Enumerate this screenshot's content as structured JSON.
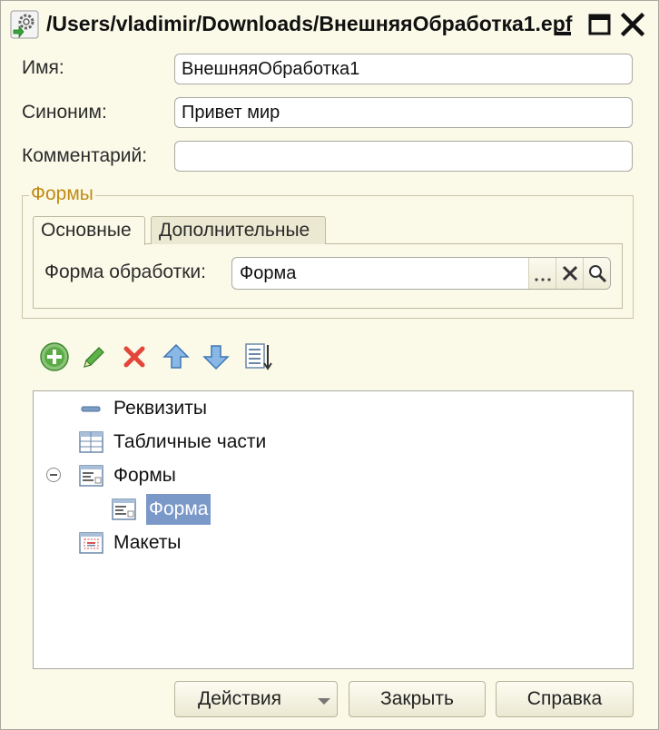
{
  "window": {
    "title": "/Users/vladimir/Downloads/ВнешняяОбработка1.epf"
  },
  "fields": {
    "name_label": "Имя:",
    "name_value": "ВнешняяОбработка1",
    "synonym_label": "Синоним:",
    "synonym_value": "Привет мир",
    "comment_label": "Комментарий:",
    "comment_value": ""
  },
  "forms_group": {
    "title": "Формы",
    "tabs": [
      {
        "label": "Основные",
        "active": true
      },
      {
        "label": "Дополнительные",
        "active": false
      }
    ],
    "form_label": "Форма обработки:",
    "form_value": "Форма",
    "choose_button": "...",
    "clear_icon": "clear-x-icon",
    "open_icon": "magnifier-icon"
  },
  "toolbar": {
    "items": [
      "add-icon",
      "edit-icon",
      "delete-icon",
      "move-up-icon",
      "move-down-icon",
      "sort-list-icon"
    ]
  },
  "tree": {
    "items": [
      {
        "label": "Реквизиты",
        "icon": "attributes-icon",
        "level": 0
      },
      {
        "label": "Табличные части",
        "icon": "table-parts-icon",
        "level": 0
      },
      {
        "label": "Формы",
        "icon": "forms-icon",
        "level": 0,
        "expanded": true
      },
      {
        "label": "Форма",
        "icon": "form-icon",
        "level": 1,
        "selected": true
      },
      {
        "label": "Макеты",
        "icon": "templates-icon",
        "level": 0
      }
    ]
  },
  "buttons": {
    "actions": "Действия",
    "close": "Закрыть",
    "help": "Справка"
  },
  "colors": {
    "background": "#fbfae9",
    "group_title": "#c08a14",
    "selection": "#7a98c8"
  }
}
